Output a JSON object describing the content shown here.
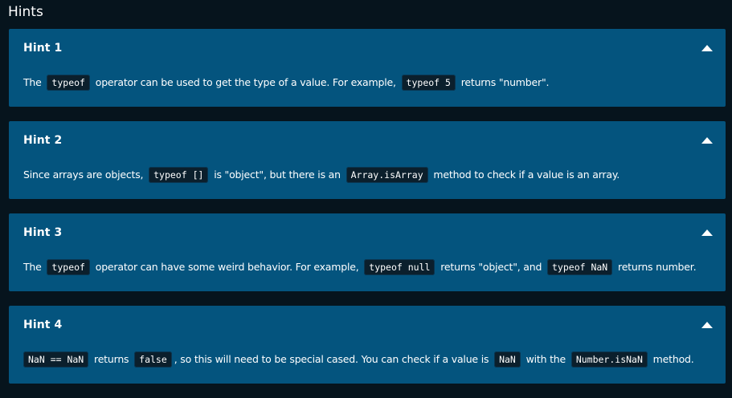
{
  "page": {
    "title": "Hints"
  },
  "hints": [
    {
      "title": "Hint 1",
      "parts": [
        {
          "type": "text",
          "value": "The "
        },
        {
          "type": "code",
          "value": "typeof"
        },
        {
          "type": "text",
          "value": " operator can be used to get the type of a value. For example, "
        },
        {
          "type": "code",
          "value": "typeof 5"
        },
        {
          "type": "text",
          "value": " returns \"number\"."
        }
      ]
    },
    {
      "title": "Hint 2",
      "parts": [
        {
          "type": "text",
          "value": "Since arrays are objects, "
        },
        {
          "type": "code",
          "value": "typeof []"
        },
        {
          "type": "text",
          "value": " is \"object\", but there is an "
        },
        {
          "type": "code",
          "value": "Array.isArray"
        },
        {
          "type": "text",
          "value": " method to check if a value is an array."
        }
      ]
    },
    {
      "title": "Hint 3",
      "parts": [
        {
          "type": "text",
          "value": "The "
        },
        {
          "type": "code",
          "value": "typeof"
        },
        {
          "type": "text",
          "value": " operator can have some weird behavior. For example, "
        },
        {
          "type": "code",
          "value": "typeof null"
        },
        {
          "type": "text",
          "value": " returns \"object\", and "
        },
        {
          "type": "code",
          "value": "typeof NaN"
        },
        {
          "type": "text",
          "value": " returns number."
        }
      ]
    },
    {
      "title": "Hint 4",
      "parts": [
        {
          "type": "code",
          "value": "NaN == NaN"
        },
        {
          "type": "text",
          "value": " returns "
        },
        {
          "type": "code",
          "value": "false"
        },
        {
          "type": "text",
          "value": ", so this will need to be special cased. You can check if a value is "
        },
        {
          "type": "code",
          "value": "NaN"
        },
        {
          "type": "text",
          "value": " with the "
        },
        {
          "type": "code",
          "value": "Number.isNaN"
        },
        {
          "type": "text",
          "value": " method."
        }
      ]
    }
  ],
  "icons": {
    "toggle": "chevron-up-icon"
  },
  "colors": {
    "background": "#06141d",
    "card": "#04547e",
    "code_background": "#0b1f2c",
    "text": "#ffffff"
  }
}
